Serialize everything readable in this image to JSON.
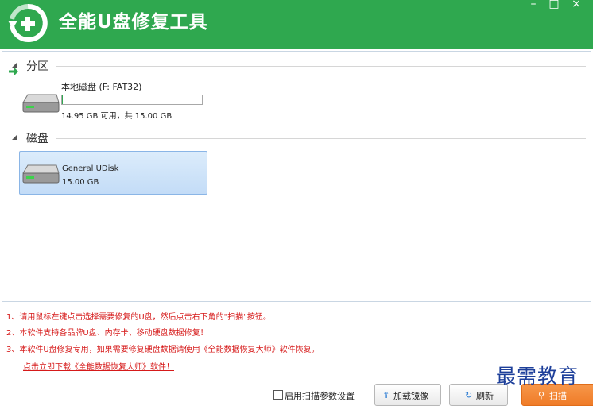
{
  "window": {
    "title": "全能U盘修复工具",
    "buttons": {
      "minimize": "–",
      "maximize": "□",
      "close": "×"
    }
  },
  "partition_group": {
    "label": "分区",
    "items": [
      {
        "name": "本地磁盘 (F: FAT32)",
        "info": "14.95 GB 可用，共 15.00 GB",
        "used_fraction": 0.003
      }
    ]
  },
  "disk_group": {
    "label": "磁盘",
    "items": [
      {
        "name": "General UDisk",
        "size": "15.00 GB",
        "selected": true
      }
    ]
  },
  "notes": [
    "1、请用鼠标左键点击选择需要修复的U盘，然后点击右下角的\"扫描\"按钮。",
    "2、本软件支持各品牌U盘、内存卡、移动硬盘数据修复！",
    "3、本软件U盘修复专用，如果需要修复硬盘数据请使用《全能数据恢复大师》软件恢复。"
  ],
  "download_link": "点击立即下载《全能数据恢复大师》软件！",
  "bottom": {
    "checkbox_label": "启用扫描参数设置",
    "load_image_button": "加载镜像",
    "refresh_button": "刷新",
    "scan_button": "扫描"
  },
  "watermark": "最需教育",
  "colors": {
    "titlebar": "#2fa84f",
    "note_text": "#d61a1a",
    "scan_button": "#ef7b27",
    "selection": "#c3dcf7"
  },
  "icons": {
    "logo": "plus-refresh-icon",
    "drive": "hard-drive-icon",
    "arrow": "green-arrow-icon"
  }
}
